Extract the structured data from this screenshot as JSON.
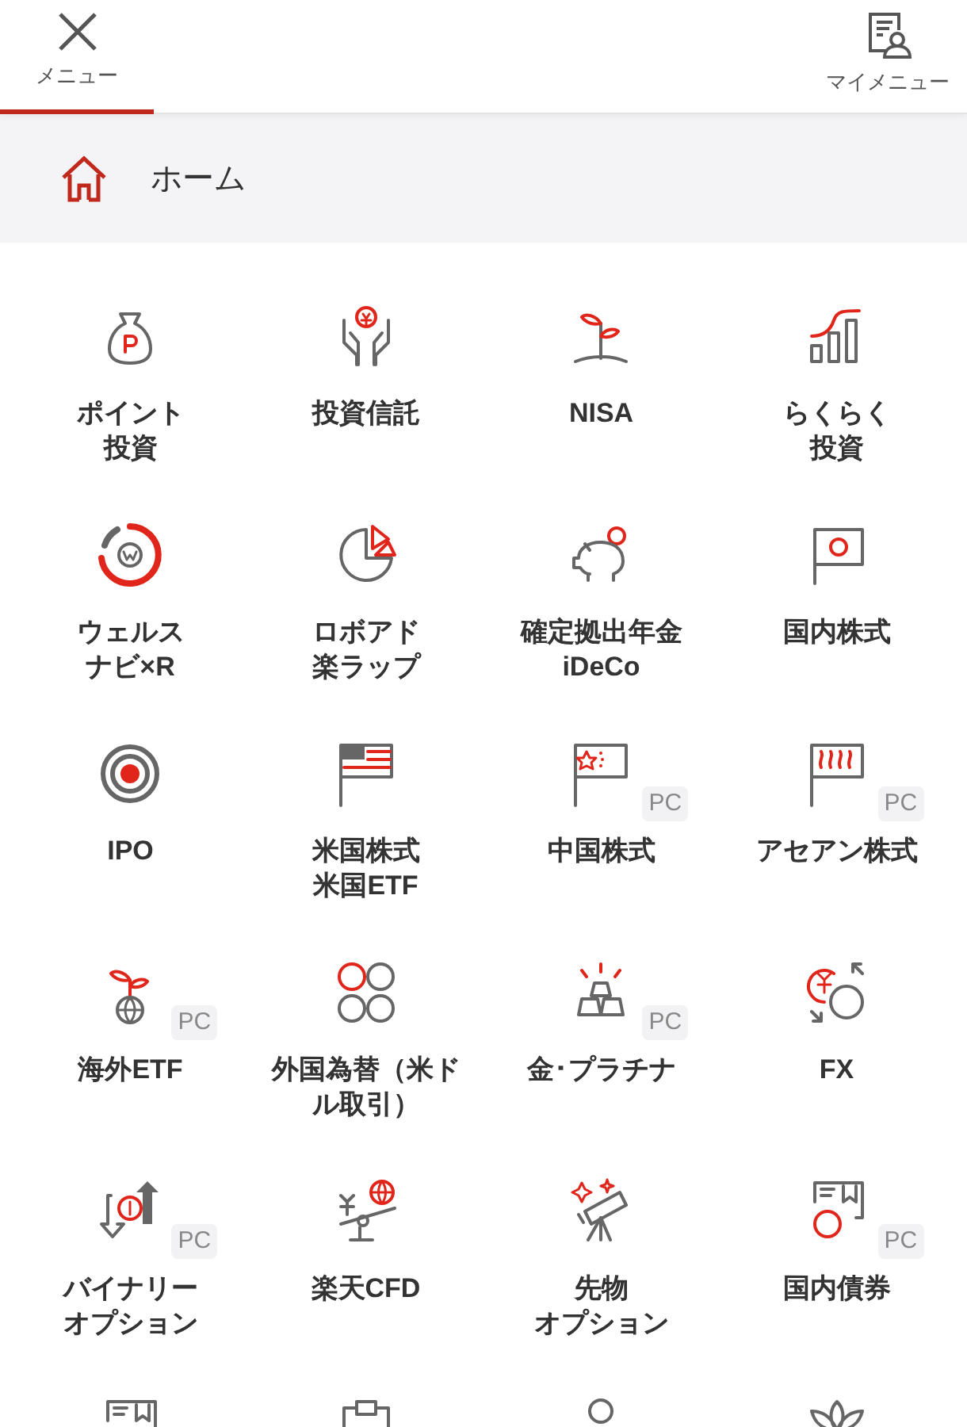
{
  "header": {
    "tabs": [
      {
        "label": "メニュー",
        "selected": true
      },
      {
        "label": "マイメニュー",
        "selected": false
      }
    ]
  },
  "home": {
    "label": "ホーム"
  },
  "items": [
    {
      "kind": "item",
      "lines": [
        "ポイント",
        "投資"
      ]
    },
    {
      "kind": "item",
      "lines": [
        "投資信託"
      ]
    },
    {
      "kind": "item",
      "lines": [
        "NISA"
      ]
    },
    {
      "kind": "item",
      "lines": [
        "らくらく",
        "投資"
      ]
    },
    {
      "kind": "item",
      "lines": [
        "ウェルス",
        "ナビ×R"
      ]
    },
    {
      "kind": "item",
      "lines": [
        "ロボアド",
        "楽ラップ"
      ]
    },
    {
      "kind": "item",
      "lines": [
        "確定拠出年金",
        "iDeCo"
      ]
    },
    {
      "kind": "item",
      "lines": [
        "国内株式"
      ]
    },
    {
      "kind": "item",
      "lines": [
        "IPO"
      ]
    },
    {
      "kind": "item",
      "lines": [
        "米国株式",
        "米国ETF"
      ]
    },
    {
      "kind": "item",
      "lines": [
        "中国株式"
      ],
      "badge": "PC"
    },
    {
      "kind": "item",
      "lines": [
        "アセアン株式"
      ],
      "badge": "PC"
    },
    {
      "kind": "item",
      "lines": [
        "海外ETF"
      ],
      "badge": "PC"
    },
    {
      "kind": "item",
      "lines": [
        "外国為替（米ド",
        "ル取引）"
      ]
    },
    {
      "kind": "item",
      "lines": [
        "金･プラチナ"
      ],
      "badge": "PC"
    },
    {
      "kind": "item",
      "lines": [
        "FX"
      ]
    },
    {
      "kind": "item",
      "lines": [
        "バイナリー",
        "オプション"
      ],
      "badge": "PC"
    },
    {
      "kind": "item",
      "lines": [
        "楽天CFD"
      ]
    },
    {
      "kind": "item",
      "lines": [
        "先物",
        "オプション"
      ]
    },
    {
      "kind": "item",
      "lines": [
        "国内債券"
      ],
      "badge": "PC"
    },
    {
      "kind": "partial"
    },
    {
      "kind": "partial"
    },
    {
      "kind": "partial"
    },
    {
      "kind": "partial"
    }
  ]
}
